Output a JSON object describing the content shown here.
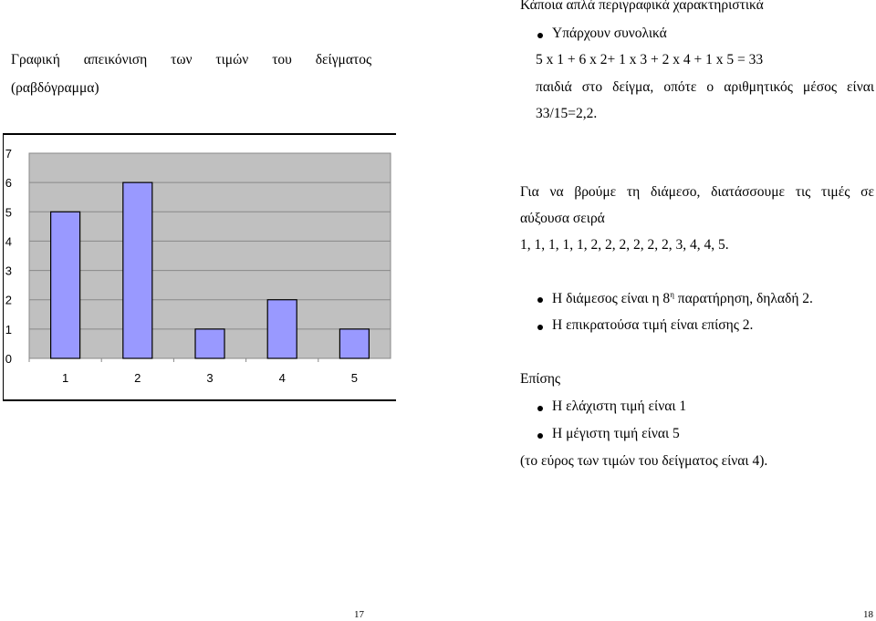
{
  "left": {
    "caption_line1": "Γραφική απεικόνιση των τιμών του δείγματος",
    "caption_line2": "(ραβδόγραμμα)"
  },
  "right": {
    "heading": "Κάποια απλά περιγραφικά χαρακτηριστικά",
    "bullet1": "Υπάρχουν συνολικά",
    "formula": "5 x 1 + 6 x 2+ 1 x 3 + 2 x 4 + 1 x 5 = 33",
    "mean_line1": "παιδιά στο δείγμα, οπότε ο αριθμητικός μέσος είναι",
    "mean_line2": "33/15=2,2.",
    "median_line1": "Για να βρούμε τη διάμεσο, διατάσσουμε τις τιμές σε",
    "median_line2": "αύξουσα σειρά",
    "sorted": "1, 1, 1, 1, 1, 2, 2, 2, 2, 2, 2, 3, 4, 4, 5.",
    "bullet2_pre": "Η διάμεσος είναι η 8",
    "bullet2_sup": "η",
    "bullet2_post": " παρατήρηση, δηλαδή 2.",
    "bullet3": "Η επικρατούσα τιμή είναι επίσης 2.",
    "also": "Επίσης",
    "bullet4": "Η ελάχιστη τιμή είναι 1",
    "bullet5": "Η μέγιστη τιμή είναι 5",
    "range": "(το εύρος των τιμών του δείγματος είναι 4)."
  },
  "footer": {
    "page_left": "17",
    "page_right": "18"
  },
  "chart_data": {
    "type": "bar",
    "categories": [
      "1",
      "2",
      "3",
      "4",
      "5"
    ],
    "values": [
      5,
      6,
      1,
      2,
      1
    ],
    "ylim": [
      0,
      7
    ],
    "yticks": [
      "0",
      "1",
      "2",
      "3",
      "4",
      "5",
      "6",
      "7"
    ],
    "grid": true,
    "bar_color": "#9999ff",
    "plot_bg": "#c0c0c0"
  }
}
